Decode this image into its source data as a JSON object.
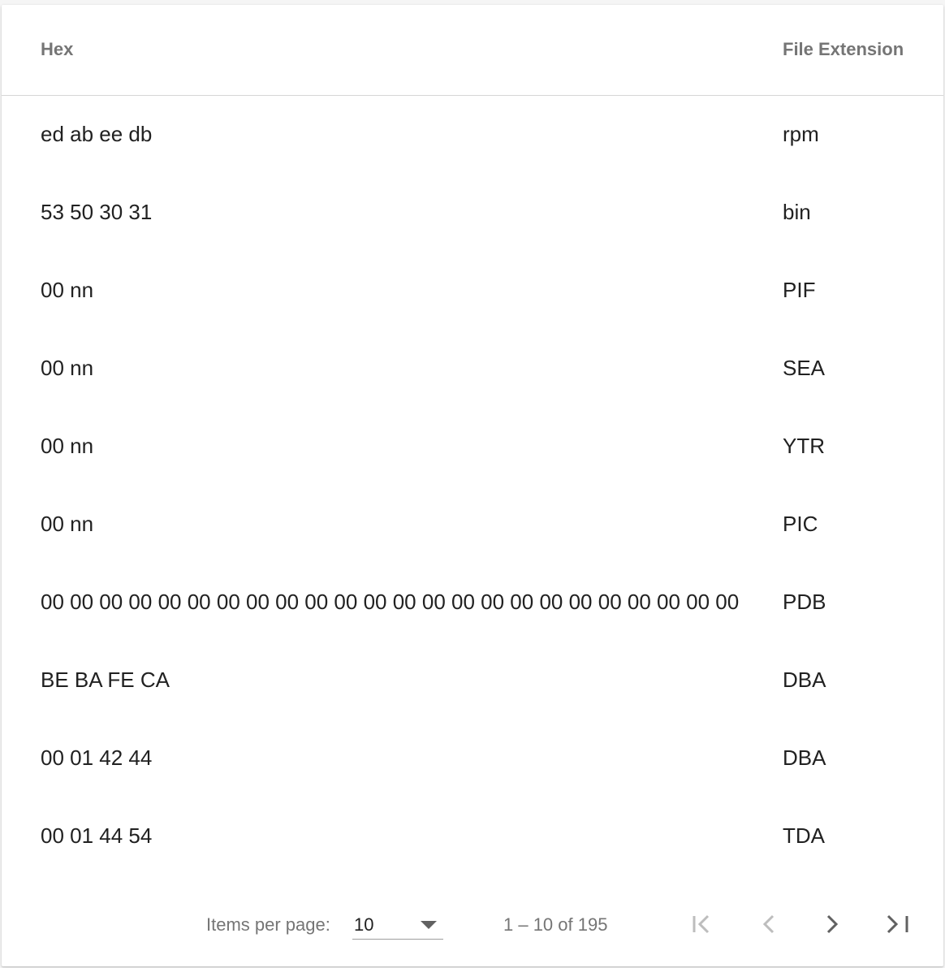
{
  "table": {
    "columns": {
      "hex": "Hex",
      "extension": "File Extension"
    },
    "rows": [
      {
        "hex": "ed ab ee db",
        "extension": "rpm"
      },
      {
        "hex": "53 50 30 31",
        "extension": "bin"
      },
      {
        "hex": "00 nn",
        "extension": "PIF"
      },
      {
        "hex": "00 nn",
        "extension": "SEA"
      },
      {
        "hex": "00 nn",
        "extension": "YTR"
      },
      {
        "hex": "00 nn",
        "extension": "PIC"
      },
      {
        "hex": "00 00 00 00 00 00 00 00 00 00 00 00 00 00 00 00 00 00 00 00 00 00 00 00",
        "extension": "PDB"
      },
      {
        "hex": "BE BA FE CA",
        "extension": "DBA"
      },
      {
        "hex": "00 01 42 44",
        "extension": "DBA"
      },
      {
        "hex": "00 01 44 54",
        "extension": "TDA"
      }
    ]
  },
  "paginator": {
    "items_per_page_label": "Items per page:",
    "items_per_page_value": "10",
    "range_label": "1 – 10 of 195",
    "icons": {
      "first": "first-page-icon",
      "prev": "chevron-left-icon",
      "next": "chevron-right-icon",
      "last": "last-page-icon"
    },
    "colors": {
      "enabled": "#616161",
      "disabled": "#bdbdbd"
    }
  }
}
